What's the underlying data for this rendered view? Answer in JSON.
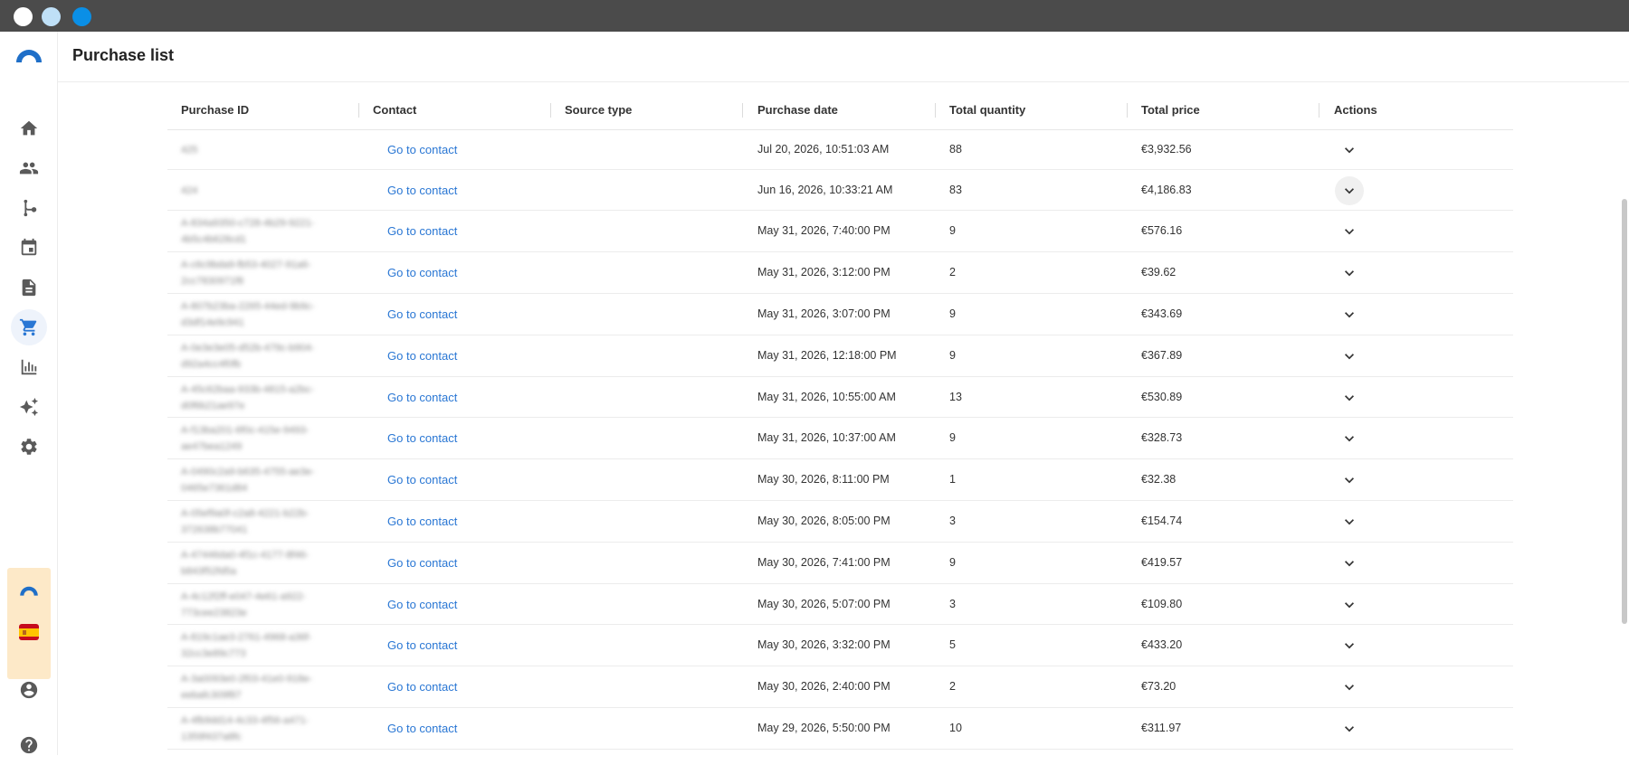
{
  "page": {
    "title": "Purchase list"
  },
  "sidebar": {
    "items": [
      {
        "name": "home-icon"
      },
      {
        "name": "contacts-icon"
      },
      {
        "name": "flows-icon"
      },
      {
        "name": "calendar-icon"
      },
      {
        "name": "document-icon"
      },
      {
        "name": "cart-icon",
        "active": true
      },
      {
        "name": "analytics-icon"
      },
      {
        "name": "sparkles-icon"
      },
      {
        "name": "gear-icon"
      }
    ],
    "bottom": [
      "account-icon",
      "help-icon"
    ]
  },
  "table": {
    "columns": [
      "Purchase ID",
      "Contact",
      "Source type",
      "Purchase date",
      "Total quantity",
      "Total price",
      "Actions"
    ],
    "rows": [
      {
        "id": "425",
        "contact": "Go to contact",
        "source": "",
        "date": "Jul 20, 2026, 10:51:03 AM",
        "qty": "88",
        "price": "€3,932.56"
      },
      {
        "id": "424",
        "contact": "Go to contact",
        "source": "",
        "date": "Jun 16, 2026, 10:33:21 AM",
        "qty": "83",
        "price": "€4,186.83"
      },
      {
        "id": "A-834a9350-c728-4b29-9221-\n4b5c4b628cd1",
        "contact": "Go to contact",
        "source": "",
        "date": "May 31, 2026, 7:40:00 PM",
        "qty": "9",
        "price": "€576.16"
      },
      {
        "id": "A-c6c9bda9-fb53-4027-91a6-\n2cc7830971f8",
        "contact": "Go to contact",
        "source": "",
        "date": "May 31, 2026, 3:12:00 PM",
        "qty": "2",
        "price": "€39.62"
      },
      {
        "id": "A-807b23ba-2265-44ed-9b9c-\nd3df14e9c941",
        "contact": "Go to contact",
        "source": "",
        "date": "May 31, 2026, 3:07:00 PM",
        "qty": "9",
        "price": "€343.69"
      },
      {
        "id": "A-0e3e3e05-d52b-479c-b904-\nd92a4cc4f0fb",
        "contact": "Go to contact",
        "source": "",
        "date": "May 31, 2026, 12:18:00 PM",
        "qty": "9",
        "price": "€367.89"
      },
      {
        "id": "A-45c62baa-933b-4815-a2bc-\nd0f6b21ae97e",
        "contact": "Go to contact",
        "source": "",
        "date": "May 31, 2026, 10:55:00 AM",
        "qty": "13",
        "price": "€530.89"
      },
      {
        "id": "A-f13ba201-6f0c-415e-9493-\nae47bea1249",
        "contact": "Go to contact",
        "source": "",
        "date": "May 31, 2026, 10:37:00 AM",
        "qty": "9",
        "price": "€328.73"
      },
      {
        "id": "A-0490c2a9-b635-4755-ae3e-\n0465e7361d84",
        "contact": "Go to contact",
        "source": "",
        "date": "May 30, 2026, 8:11:00 PM",
        "qty": "1",
        "price": "€32.38"
      },
      {
        "id": "A-05ef9a0f-c2a8-4221-b22b-\n372638b77041",
        "contact": "Go to contact",
        "source": "",
        "date": "May 30, 2026, 8:05:00 PM",
        "qty": "3",
        "price": "€154.74"
      },
      {
        "id": "A-47446da0-4f1c-4177-8f46-\nb843f52fd5a",
        "contact": "Go to contact",
        "source": "",
        "date": "May 30, 2026, 7:41:00 PM",
        "qty": "9",
        "price": "€419.57"
      },
      {
        "id": "A-4c12f2ff-e047-4e61-a922-\n773cee23823e",
        "contact": "Go to contact",
        "source": "",
        "date": "May 30, 2026, 5:07:00 PM",
        "qty": "3",
        "price": "€109.80"
      },
      {
        "id": "A-819c1ae3-2761-4968-a36f-\n32cc3e89c773",
        "contact": "Go to contact",
        "source": "",
        "date": "May 30, 2026, 3:32:00 PM",
        "qty": "5",
        "price": "€433.20"
      },
      {
        "id": "A-3a0093e0-2f03-41e0-918e-\neebafc309f87",
        "contact": "Go to contact",
        "source": "",
        "date": "May 30, 2026, 2:40:00 PM",
        "qty": "2",
        "price": "€73.20"
      },
      {
        "id": "A-4fb9dd14-4c33-4f56-a471-\n1359f437a8fc",
        "contact": "Go to contact",
        "source": "",
        "date": "May 29, 2026, 5:50:00 PM",
        "qty": "10",
        "price": "€311.97"
      }
    ]
  }
}
